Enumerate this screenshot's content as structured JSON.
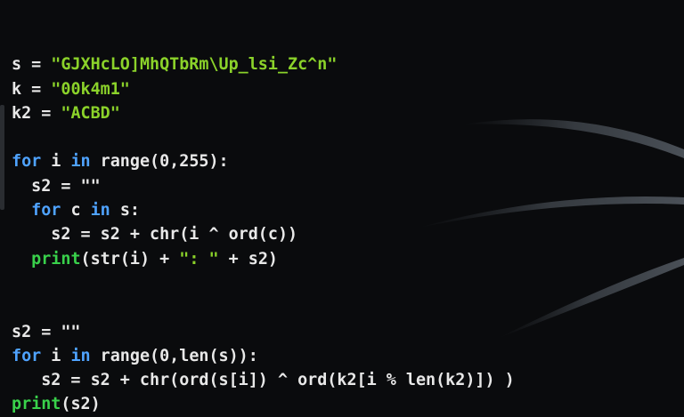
{
  "code": {
    "lines": [
      [],
      [
        {
          "t": "plain",
          "v": "s = "
        },
        {
          "t": "str",
          "v": "\"GJXHcLO]MhQTbRm\\Up_lsi_Zc^n\""
        }
      ],
      [
        {
          "t": "plain",
          "v": "k = "
        },
        {
          "t": "str",
          "v": "\"00k4m1\""
        }
      ],
      [
        {
          "t": "plain",
          "v": "k2 = "
        },
        {
          "t": "str",
          "v": "\"ACBD\""
        }
      ],
      [],
      [
        {
          "t": "kw",
          "v": "for"
        },
        {
          "t": "plain",
          "v": " i "
        },
        {
          "t": "kw",
          "v": "in"
        },
        {
          "t": "plain",
          "v": " range(0,255):"
        }
      ],
      [
        {
          "t": "plain",
          "v": "  s2 = \"\""
        }
      ],
      [
        {
          "t": "plain",
          "v": "  "
        },
        {
          "t": "kw",
          "v": "for"
        },
        {
          "t": "plain",
          "v": " c "
        },
        {
          "t": "kw",
          "v": "in"
        },
        {
          "t": "plain",
          "v": " s:"
        }
      ],
      [
        {
          "t": "plain",
          "v": "    s2 = s2 + chr(i ^ ord(c))"
        }
      ],
      [
        {
          "t": "plain",
          "v": "  "
        },
        {
          "t": "fn",
          "v": "print"
        },
        {
          "t": "plain",
          "v": "(str(i) + "
        },
        {
          "t": "str",
          "v": "\": \""
        },
        {
          "t": "plain",
          "v": " + s2)"
        }
      ],
      [],
      [],
      [
        {
          "t": "plain",
          "v": "s2 = \"\""
        }
      ],
      [
        {
          "t": "kw",
          "v": "for"
        },
        {
          "t": "plain",
          "v": " i "
        },
        {
          "t": "kw",
          "v": "in"
        },
        {
          "t": "plain",
          "v": " range(0,len(s)):"
        }
      ],
      [
        {
          "t": "plain",
          "v": "   s2 = s2 + chr(ord(s[i]) ^ ord(k2[i % len(k2)]) )"
        }
      ],
      [
        {
          "t": "fn",
          "v": "print"
        },
        {
          "t": "plain",
          "v": "(s2)"
        }
      ]
    ]
  },
  "colors": {
    "background": "#0a0b0d",
    "keyword": "#4fa3ff",
    "builtin": "#39d14b",
    "string": "#8bd22a",
    "text": "#e8e8e8"
  }
}
